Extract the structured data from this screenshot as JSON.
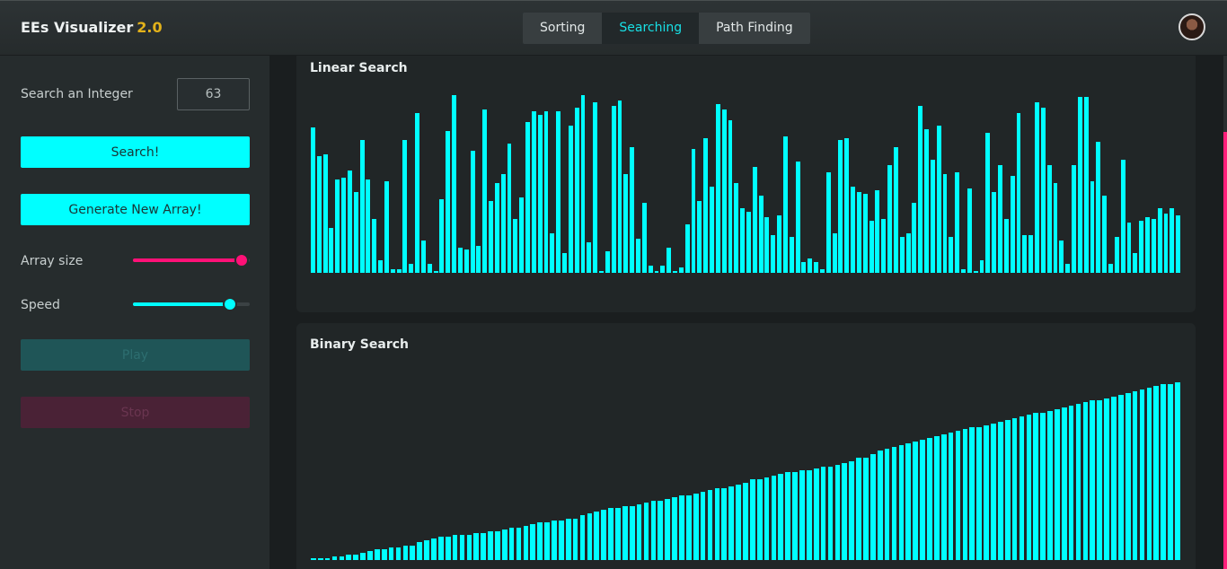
{
  "app": {
    "title": "EEs Visualizer",
    "version": "2.0",
    "accent": "#00ffff",
    "brand_version_color": "#e3b21a"
  },
  "nav": {
    "tabs": [
      {
        "label": "Sorting",
        "active": false
      },
      {
        "label": "Searching",
        "active": true
      },
      {
        "label": "Path Finding",
        "active": false
      }
    ]
  },
  "sidebar": {
    "search_label": "Search an Integer",
    "search_value": "63",
    "search_button": "Search!",
    "generate_button": "Generate New Array!",
    "array_size_label": "Array size",
    "array_size_level": 0.93,
    "array_size_color": "#ff1177",
    "speed_label": "Speed",
    "speed_level": 0.83,
    "speed_color": "#00ffff",
    "play_button": "Play",
    "stop_button": "Stop"
  },
  "linear": {
    "title": "Linear Search",
    "values": [
      81,
      65,
      66,
      25,
      52,
      53,
      57,
      45,
      74,
      52,
      30,
      7,
      51,
      2,
      2,
      74,
      5,
      89,
      18,
      5,
      1,
      41,
      79,
      99,
      14,
      13,
      68,
      15,
      91,
      40,
      50,
      55,
      72,
      30,
      42,
      84,
      90,
      88,
      90,
      22,
      90,
      11,
      82,
      92,
      99,
      17,
      95,
      1,
      12,
      93,
      96,
      55,
      70,
      19,
      39,
      4,
      1,
      4,
      14,
      1,
      3,
      27,
      69,
      40,
      75,
      48,
      94,
      91,
      85,
      50,
      36,
      34,
      59,
      43,
      31,
      21,
      32,
      76,
      20,
      62,
      6,
      8,
      6,
      2,
      56,
      22,
      74,
      75,
      48,
      45,
      44,
      29,
      46,
      30,
      60,
      70,
      20,
      22,
      39,
      93,
      80,
      63,
      82,
      55,
      20,
      56,
      2,
      47,
      1,
      7,
      78,
      45,
      60,
      30,
      54,
      89,
      21,
      21,
      95,
      92,
      60,
      50,
      18,
      5,
      60,
      98,
      98,
      51,
      73,
      43,
      5,
      20,
      63,
      28,
      11,
      29,
      31,
      30,
      36,
      33,
      36,
      32
    ],
    "height_scale": 200
  },
  "binary": {
    "title": "Binary Search",
    "values": [
      1,
      1,
      1,
      2,
      2,
      3,
      3,
      4,
      5,
      6,
      6,
      7,
      7,
      8,
      8,
      10,
      11,
      12,
      13,
      13,
      14,
      14,
      14,
      15,
      15,
      16,
      16,
      17,
      18,
      18,
      19,
      20,
      21,
      21,
      22,
      22,
      23,
      23,
      25,
      26,
      27,
      28,
      29,
      29,
      30,
      30,
      31,
      32,
      33,
      33,
      34,
      35,
      36,
      36,
      37,
      38,
      39,
      40,
      40,
      41,
      42,
      43,
      45,
      45,
      46,
      47,
      48,
      49,
      49,
      50,
      50,
      51,
      52,
      52,
      53,
      54,
      55,
      57,
      57,
      59,
      61,
      62,
      63,
      64,
      65,
      66,
      67,
      68,
      69,
      70,
      71,
      72,
      73,
      74,
      74,
      75,
      76,
      77,
      78,
      79,
      80,
      81,
      82,
      82,
      83,
      84,
      85,
      86,
      87,
      88,
      89,
      89,
      90,
      91,
      92,
      93,
      94,
      95,
      96,
      97,
      98,
      98,
      99
    ]
  }
}
